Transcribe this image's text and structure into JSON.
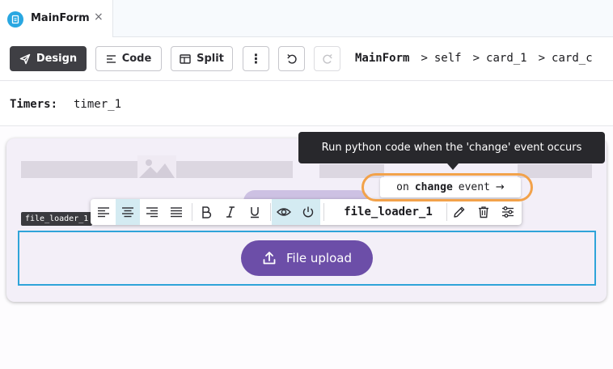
{
  "tab": {
    "title": "MainForm",
    "close_glyph": "×",
    "icon": "form-file-icon"
  },
  "toolbar": {
    "design_label": "Design",
    "code_label": "Code",
    "split_label": "Split",
    "more_glyph": "⋮",
    "active_color": "#3f3f44"
  },
  "breadcrumb": {
    "items": [
      "MainForm",
      "self",
      "card_1",
      "card_c"
    ],
    "separator": ">"
  },
  "timers": {
    "label": "Timers:",
    "value": "timer_1"
  },
  "component": {
    "tag": "file_loader_1",
    "name": "file_loader_1",
    "upload_label": "File upload",
    "upload_color": "#6c4ea8",
    "selection_color": "#2fa4d9"
  },
  "event": {
    "prefix": "on",
    "name": "change",
    "suffix": "event",
    "arrow": "→",
    "ring_color": "#f2a24a"
  },
  "tooltip": {
    "text": "Run python code when the 'change' event occurs"
  }
}
